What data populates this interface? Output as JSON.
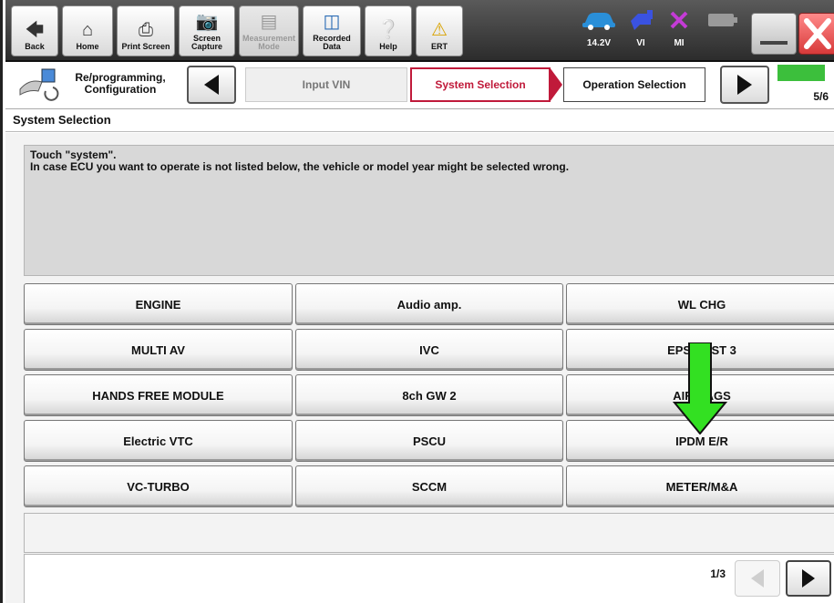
{
  "toolbar": {
    "back_label": "Back",
    "home_label": "Home",
    "print_label": "Print Screen",
    "capture_label": "Screen\nCapture",
    "measure_label": "Measurement\nMode",
    "recorded_label": "Recorded\nData",
    "help_label": "Help",
    "ert_label": "ERT"
  },
  "status": {
    "voltage": "14.2V",
    "vi_label": "VI",
    "mi_label": "MI"
  },
  "nav": {
    "title": "Re/programming, Configuration",
    "steps": [
      "Input VIN",
      "System Selection",
      "Operation Selection"
    ],
    "progress": "5/6",
    "progress_fraction": 0.833
  },
  "section_title": "System Selection",
  "message": {
    "line1": "Touch \"system\".",
    "line2": "In case ECU you want to operate is not listed below, the vehicle or model year might be selected wrong."
  },
  "systems": [
    [
      "ENGINE",
      "Audio amp.",
      "WL CHG"
    ],
    [
      "MULTI AV",
      "IVC",
      "EPS/DAST 3"
    ],
    [
      "HANDS FREE MODULE",
      "8ch GW 2",
      "AIR BAGS"
    ],
    [
      "Electric VTC",
      "PSCU",
      "IPDM E/R"
    ],
    [
      "VC-TURBO",
      "SCCM",
      "METER/M&A"
    ]
  ],
  "pager": {
    "page": "1/3"
  },
  "colors": {
    "active_step": "#c01a3a",
    "progress_fill": "#3cbf3c",
    "pointer_arrow": "#33e022"
  }
}
